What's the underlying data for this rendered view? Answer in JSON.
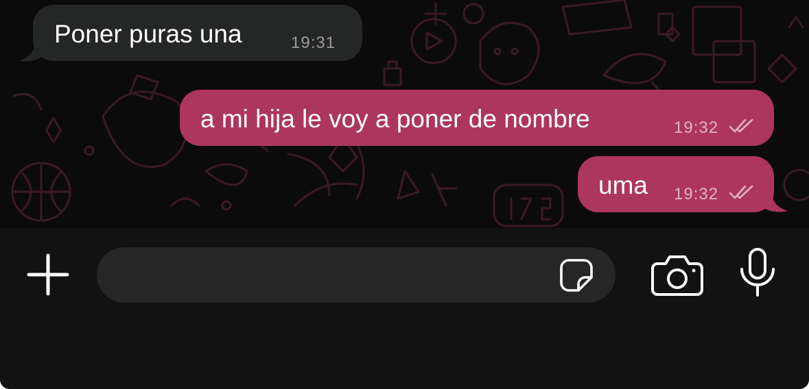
{
  "messages": [
    {
      "direction": "incoming",
      "text": "Poner puras una",
      "time": "19:31"
    },
    {
      "direction": "outgoing",
      "text": "a mi hija le voy a poner de nombre",
      "time": "19:32",
      "status": "read"
    },
    {
      "direction": "outgoing",
      "text": "uma",
      "time": "19:32",
      "status": "read"
    }
  ],
  "composer": {
    "value": "",
    "placeholder": ""
  },
  "icons": {
    "attach": "plus-icon",
    "sticker": "sticker-icon",
    "camera": "camera-icon",
    "mic": "microphone-icon",
    "read_receipt": "double-check-icon"
  },
  "colors": {
    "outgoing_bubble": "#ad365e",
    "incoming_bubble": "#252626",
    "chat_background": "#0c0b0c",
    "input_bar": "#121212",
    "input_field": "#262626",
    "wallpaper_doodle": "#3a1a28"
  }
}
